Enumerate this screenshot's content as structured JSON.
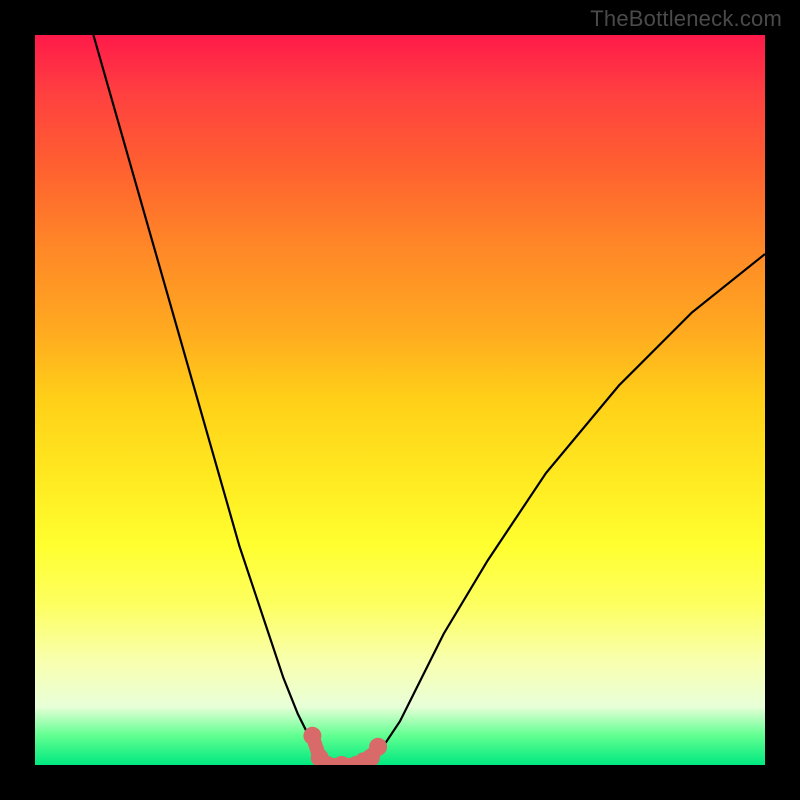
{
  "attribution": "TheBottleneck.com",
  "chart_data": {
    "type": "line",
    "title": "",
    "xlabel": "",
    "ylabel": "",
    "xlim": [
      0,
      100
    ],
    "ylim": [
      0,
      100
    ],
    "series": [
      {
        "name": "bottleneck-curve",
        "x": [
          8,
          12,
          16,
          20,
          24,
          28,
          32,
          34,
          36,
          38,
          39,
          40,
          42,
          44,
          46,
          48,
          50,
          52,
          56,
          62,
          70,
          80,
          90,
          100
        ],
        "y": [
          100,
          86,
          72,
          58,
          44,
          30,
          18,
          12,
          7,
          3,
          1,
          0,
          0,
          0,
          1,
          3,
          6,
          10,
          18,
          28,
          40,
          52,
          62,
          70
        ]
      }
    ],
    "markers": {
      "name": "highlight-points",
      "color": "#d86a6a",
      "x": [
        38,
        39,
        40,
        42,
        44,
        45,
        46,
        47
      ],
      "y": [
        4,
        1,
        0,
        0,
        0,
        0.5,
        1,
        2.5
      ]
    }
  }
}
